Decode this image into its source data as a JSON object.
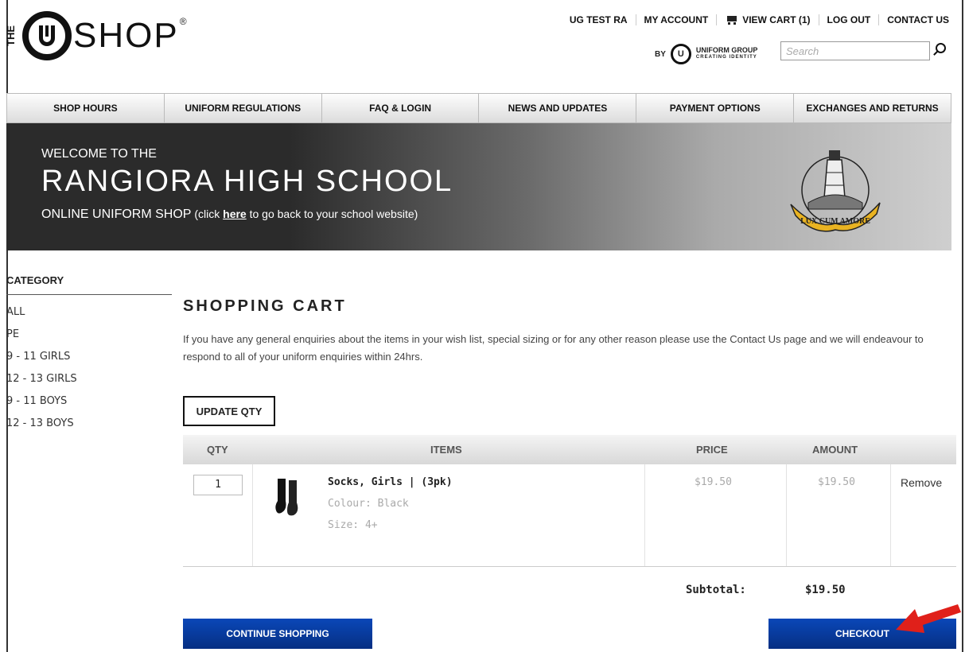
{
  "header": {
    "logo_the": "THE",
    "logo_shop": "SHOP",
    "logo_reg": "®",
    "top_links": [
      {
        "label": "UG TEST RA"
      },
      {
        "label": "MY ACCOUNT"
      },
      {
        "label": "VIEW CART (1)",
        "icon": "cart-icon"
      },
      {
        "label": "LOG OUT"
      },
      {
        "label": "CONTACT US"
      }
    ],
    "by_label": "BY",
    "ug_mark": "U",
    "ug_name": "UNIFORM GROUP",
    "ug_tagline": "CREATING IDENTITY",
    "search_placeholder": "Search"
  },
  "nav": [
    "SHOP HOURS",
    "UNIFORM REGULATIONS",
    "FAQ & LOGIN",
    "NEWS AND UPDATES",
    "PAYMENT OPTIONS",
    "EXCHANGES AND RETURNS"
  ],
  "banner": {
    "line1": "WELCOME TO THE",
    "line2": "RANGIORA HIGH SCHOOL",
    "line3_prefix": "ONLINE UNIFORM SHOP",
    "line3_paren_open": " (click ",
    "line3_link": "here",
    "line3_suffix": " to go back to your school website)",
    "crest_motto": "LUX CUM AMORE"
  },
  "sidebar": {
    "title": "CATEGORY",
    "items": [
      "ALL",
      "PE",
      "9 - 11 GIRLS",
      "12 - 13 GIRLS",
      "9 - 11 BOYS",
      "12 - 13 BOYS"
    ]
  },
  "cart": {
    "title": "SHOPPING CART",
    "intro": "If you have any general enquiries about the items in your wish list, special sizing or for any other reason please use the Contact Us page and we will endeavour to respond to all of your uniform enquiries within 24hrs.",
    "update_label": "UPDATE QTY",
    "columns": {
      "qty": "QTY",
      "items": "ITEMS",
      "price": "PRICE",
      "amount": "AMOUNT"
    },
    "rows": [
      {
        "qty": "1",
        "name": "Socks, Girls | (3pk)",
        "colour": "Colour: Black",
        "size": "Size: 4+",
        "price": "$19.50",
        "amount": "$19.50",
        "remove": "Remove"
      }
    ],
    "subtotal_label": "Subtotal:",
    "subtotal_value": "$19.50",
    "continue_label": "CONTINUE SHOPPING",
    "checkout_label": "CHECKOUT"
  },
  "colors": {
    "button_blue": "#0a47b8",
    "arrow_red": "#e0201a",
    "banner_dark": "#2b2b2b"
  }
}
